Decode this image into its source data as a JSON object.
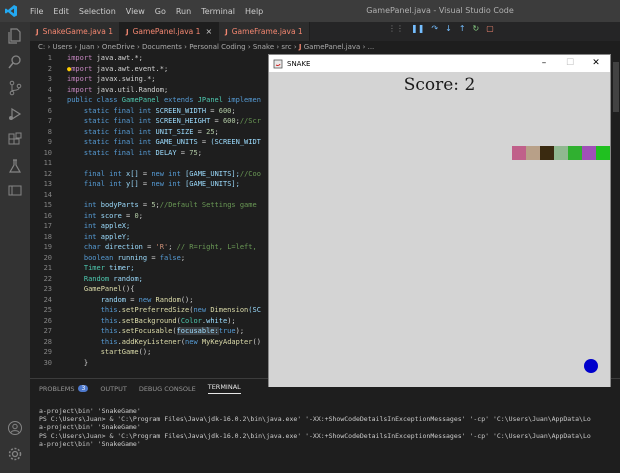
{
  "titlebar": {
    "menu": [
      "File",
      "Edit",
      "Selection",
      "View",
      "Go",
      "Run",
      "Terminal",
      "Help"
    ],
    "title": "GamePanel.java - Visual Studio Code"
  },
  "tabs": [
    {
      "label": "SnakeGame.java 1"
    },
    {
      "label": "GamePanel.java 1",
      "close": "×"
    },
    {
      "label": "GameFrame.java 1"
    }
  ],
  "breadcrumb": [
    "C:",
    "Users",
    "Juan",
    "OneDrive",
    "Documents",
    "Personal Coding",
    "Snake",
    "src",
    "GamePanel.java",
    "..."
  ],
  "code": {
    "line_numbers": [
      "1",
      "2",
      "3",
      "4",
      "5",
      "6",
      "7",
      "8",
      "9",
      "10",
      "11",
      "12",
      "13",
      "14",
      "15",
      "16",
      "17",
      "18",
      "19",
      "20",
      "21",
      "22",
      "23",
      "24",
      "25",
      "26",
      "27",
      "28",
      "29",
      "30"
    ],
    "imports": [
      "java.awt.*;",
      "java.awt.event.*;",
      "javax.swing.*;",
      "java.util.Random;"
    ],
    "t_import": "import",
    "l5a": "public class",
    "l5b": "GamePanel",
    "l5c": "extends",
    "l5d": "JPanel",
    "l5e": "implemen",
    "sf": "static final int",
    "l6": "SCREEN_WIDTH",
    "l6v": "600",
    "l7": "SCREEN_HEIGHT",
    "l7v": "600",
    "l7c": "//Scr",
    "l8": "UNIT_SIZE",
    "l8v": "25",
    "l9": "GAME_UNITS",
    "l9v": "(SCREEN_WIDT",
    "l10": "DELAY",
    "l10v": "75",
    "l12a": "final int",
    "l12b": "x[]",
    "l12c": "new int",
    "l12d": "[GAME_UNITS];",
    "l12e": "//Coo",
    "l13a": "final int",
    "l13b": "y[]",
    "l13c": "new int",
    "l13d": "[GAME_UNITS];",
    "l15a": "int",
    "l15b": "bodyParts",
    "l15c": "5",
    "l15d": "//Default Settings game",
    "l16a": "int",
    "l16b": "score",
    "l16c": "0",
    "l17a": "int",
    "l17b": "appleX;",
    "l18a": "int",
    "l18b": "appleY;",
    "l19a": "char",
    "l19b": "direction",
    "l19c": "'R'",
    "l19d": "// R=right, L=left,",
    "l20a": "boolean",
    "l20b": "running",
    "l20c": "false",
    "l21a": "Timer",
    "l21b": "timer;",
    "l22a": "Random",
    "l22b": "random;",
    "l23a": "GamePanel",
    "l24a": "random",
    "l24b": "new",
    "l24c": "Random",
    "l25a": "this",
    "l25b": "setPreferredSize",
    "l25c": "new",
    "l25d": "Dimension",
    "l25e": "(SC",
    "l26a": "this",
    "l26b": "setBackground",
    "l26c": "Color",
    "l26d": "white",
    "l27a": "this",
    "l27b": "setFocusable",
    "l27c": "focusable:",
    "l27d": "true",
    "l28a": "this",
    "l28b": "addKeyListener",
    "l28c": "new",
    "l28d": "MyKeyAdapter",
    "l29a": "startGame"
  },
  "panel": {
    "tabs": [
      "PROBLEMS",
      "OUTPUT",
      "DEBUG CONSOLE",
      "TERMINAL"
    ],
    "problems_count": "3",
    "terminal": [
      "a-project\\bin' 'SnakeGame'",
      "PS C:\\Users\\Juan>  & 'C:\\Program Files\\Java\\jdk-16.0.2\\bin\\java.exe' '-XX:+ShowCodeDetailsInExceptionMessages' '-cp' 'C:\\Users\\Juan\\AppData\\Lo",
      "a-project\\bin' 'SnakeGame'",
      "PS C:\\Users\\Juan>  & 'C:\\Program Files\\Java\\jdk-16.0.2\\bin\\java.exe' '-XX:+ShowCodeDetailsInExceptionMessages' '-cp' 'C:\\Users\\Juan\\AppData\\Lo",
      "a-project\\bin' 'SnakeGame'"
    ]
  },
  "snake_window": {
    "title": "SNAKE",
    "minimize": "–",
    "maximize": "☐",
    "close": "✕",
    "score_text": "Score: 2",
    "snake_colors": [
      "#c0608a",
      "#b8a088",
      "#3a2a10",
      "#90b890",
      "#30b030",
      "#a050b8",
      "#20c020"
    ],
    "apple_color": "#0000cc"
  }
}
